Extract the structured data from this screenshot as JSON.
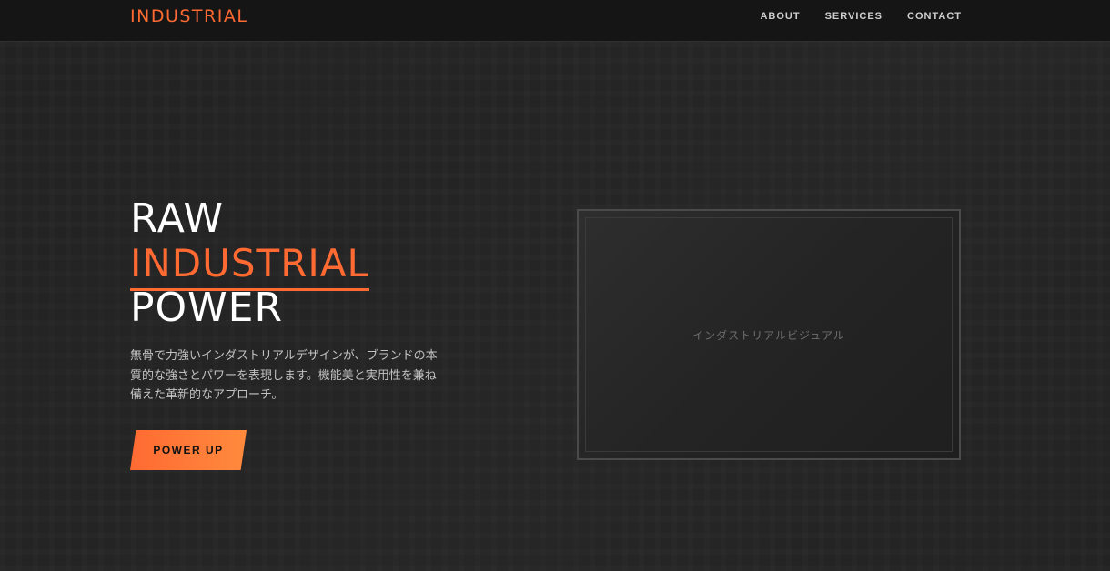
{
  "brand": {
    "logo_text": "INDUSTRIAL",
    "accent_color": "#ff6a33"
  },
  "nav": {
    "items": [
      {
        "label": "ABOUT"
      },
      {
        "label": "SERVICES"
      },
      {
        "label": "CONTACT"
      }
    ]
  },
  "hero": {
    "headline_line1": "RAW",
    "headline_line2": "INDUSTRIAL",
    "headline_line3": "POWER",
    "description": "無骨で力強いインダストリアルデザインが、ブランドの本質的な強さとパワーを表現します。機能美と実用性を兼ね備えた革新的なアプローチ。",
    "cta_label": "POWER UP",
    "visual_label": "インダストリアルビジュアル"
  }
}
